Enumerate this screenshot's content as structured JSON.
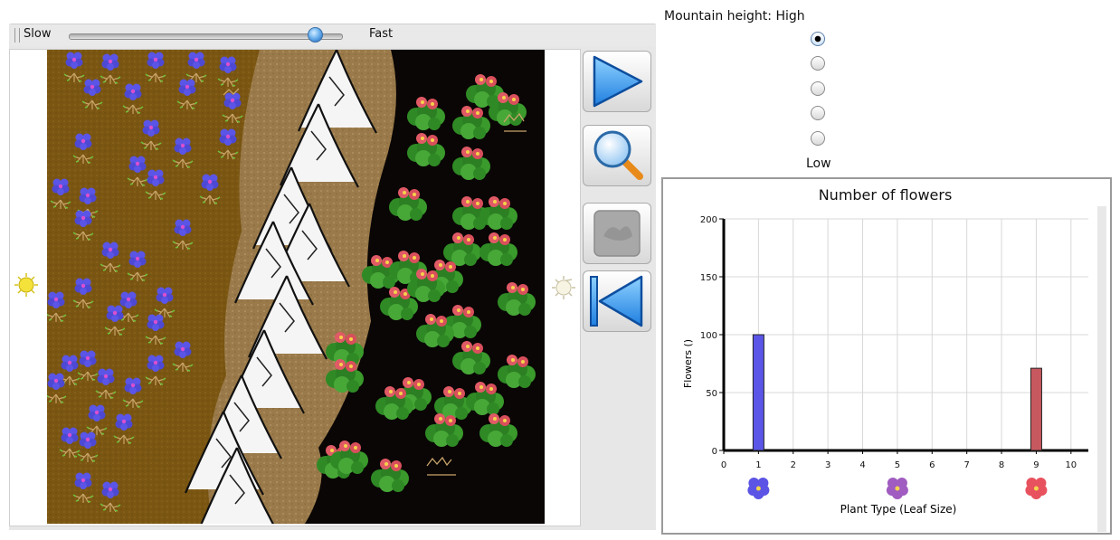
{
  "speed": {
    "slow_label": "Slow",
    "fast_label": "Fast",
    "level": 0.93
  },
  "mountain": {
    "label": "Mountain height:",
    "high_label": "High",
    "low_label": "Low",
    "options": 5,
    "selected_index": 0
  },
  "tools": {
    "play_icon": "play-triangle-icon",
    "magnifier_icon": "magnifier-icon",
    "terrain_icon": "terrain-icon",
    "rewind_icon": "rewind-icon"
  },
  "colors": {
    "blue_flower": "#5a55e6",
    "red_flower": "#e05a66",
    "soil": "#7a5612",
    "dark_zone": "#0a0605"
  },
  "chart_data": {
    "type": "bar",
    "title": "Number of flowers",
    "xlabel": "Plant Type (Leaf Size)",
    "ylabel": "Flowers ()",
    "xlim": [
      0,
      10.5
    ],
    "ylim": [
      0,
      200
    ],
    "xticks": [
      0,
      1,
      2,
      3,
      4,
      5,
      6,
      7,
      8,
      9,
      10
    ],
    "yticks": [
      0,
      50,
      100,
      150,
      200
    ],
    "grid": true,
    "bars": [
      {
        "x": 1,
        "value": 100,
        "color": "#5a55e6"
      },
      {
        "x": 9,
        "value": 71,
        "color": "#c8585f"
      }
    ],
    "markers": [
      {
        "x": 1,
        "color": "#5c54e4",
        "icon": "blue-flower-icon"
      },
      {
        "x": 5,
        "color": "#a05cc0",
        "icon": "purple-flower-icon"
      },
      {
        "x": 9,
        "color": "#e8525e",
        "icon": "red-flower-icon"
      }
    ]
  }
}
